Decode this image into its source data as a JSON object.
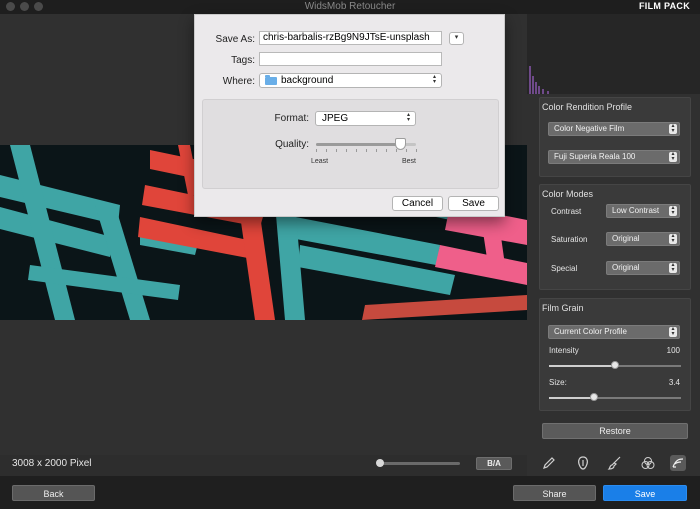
{
  "window": {
    "title": "WidsMob Retoucher",
    "mode": "FILM PACK"
  },
  "preview": {
    "dimensions": "3008 x 2000 Pixel",
    "before_after_label": "B/A",
    "zoom_level": 0.0
  },
  "save_dialog": {
    "save_as_label": "Save As:",
    "filename": "chris-barbalis-rzBg9N9JTsE-unsplash",
    "tags_label": "Tags:",
    "tags_value": "",
    "where_label": "Where:",
    "where_value": "background",
    "format_label": "Format:",
    "format_value": "JPEG",
    "quality_label": "Quality:",
    "quality_min_label": "Least",
    "quality_max_label": "Best",
    "quality_value": 0.85,
    "cancel_label": "Cancel",
    "save_label": "Save"
  },
  "panel": {
    "color_rendition": {
      "title": "Color Rendition Profile",
      "profile": "Color Negative Film",
      "film": "Fuji Superia Reala 100"
    },
    "color_modes": {
      "title": "Color Modes",
      "contrast_label": "Contrast",
      "contrast_value": "Low Contrast",
      "saturation_label": "Saturation",
      "saturation_value": "Original",
      "special_label": "Special",
      "special_value": "Original"
    },
    "film_grain": {
      "title": "Film Grain",
      "profile": "Current Color Profile",
      "intensity_label": "Intensity",
      "intensity_value": "100",
      "intensity_fraction": 0.5,
      "size_label": "Size:",
      "size_value": "3.4",
      "size_fraction": 0.34
    },
    "restore_label": "Restore",
    "tools": [
      "pencil-icon",
      "retouch-icon",
      "brush-icon",
      "color-circles-icon",
      "film-icon"
    ]
  },
  "bottom": {
    "back_label": "Back",
    "share_label": "Share",
    "save_label": "Save"
  },
  "colors": {
    "accent_blue": "#1a7fe8",
    "chair_teal": "#3fa5a5",
    "chair_red": "#e0453a",
    "chair_pink": "#ef5f8a"
  }
}
